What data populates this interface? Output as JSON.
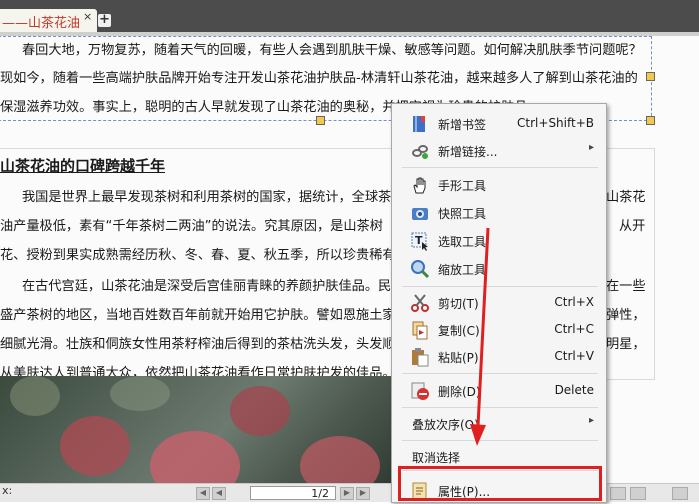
{
  "tab": {
    "label": "——山茶花油",
    "close": "×",
    "add": "+"
  },
  "document": {
    "para1": [
      "春回大地，万物复苏，随着天气的回暖，有些人会遇到肌肤干燥、敏感等问题。如何解决肌肤季节问题呢？",
      "现如今，随着一些高端护肤品牌开始专注开发山茶花油护肤品-林清轩山茶花油，越来越多人了解到山茶花油的",
      "保湿滋养功效。事实上，聪明的古人早就发现了山茶花油的奥秘，并把它视为珍贵的护肤品。"
    ],
    "heading": "山茶花油的口碑跨越千年",
    "para2": [
      "我国是世界上最早发现茶树和利用茶树的国家，据统计，全球茶",
      "油产量极低，素有“千年茶树二两油”的说法。究其原因，是山茶树",
      "花、授粉到果实成熟需经历秋、冬、春、夏、秋五季，所以珍贵稀有"
    ],
    "para2_right": [
      "山茶花",
      "从开"
    ],
    "para3": [
      "在古代宫廷，山茶花油是深受后宫佳丽青睐的养颜护肤佳品。民",
      "盛产茶树的地区，当地百姓数百年前就开始用它护肤。譬如恩施土家",
      "细腻光滑。壮族和侗族女性用茶籽榨油后得到的茶枯洗头发，头发顺",
      "从美肤达人到普通大众，依然把山茶花油看作日常护肤护发的佳品。"
    ],
    "para3_right": [
      "在一些",
      "弹性，",
      "明星，"
    ]
  },
  "status": {
    "left": "x:",
    "page": "1/2"
  },
  "context_menu": {
    "items": [
      {
        "label": "新增书签",
        "shortcut": "Ctrl+Shift+B",
        "icon": "bookmark-icon"
      },
      {
        "label": "新增链接...",
        "submenu": "▸",
        "icon": "link-icon"
      },
      {
        "label": "手形工具",
        "icon": "hand-icon"
      },
      {
        "label": "快照工具",
        "icon": "camera-icon"
      },
      {
        "label": "选取工具",
        "icon": "text-select-icon"
      },
      {
        "label": "缩放工具",
        "icon": "zoom-icon"
      },
      {
        "label": "剪切(T)",
        "shortcut": "Ctrl+X",
        "icon": "scissors-icon"
      },
      {
        "label": "复制(C)",
        "shortcut": "Ctrl+C",
        "icon": "copy-icon"
      },
      {
        "label": "粘贴(P)",
        "shortcut": "Ctrl+V",
        "icon": "paste-icon"
      },
      {
        "label": "删除(D)",
        "shortcut": "Delete",
        "icon": "delete-icon"
      },
      {
        "label": "叠放次序(O)",
        "submenu": "▸"
      },
      {
        "label": "取消选择"
      },
      {
        "label": "属性(P)...",
        "icon": "properties-icon"
      }
    ]
  },
  "colors": {
    "highlight": "#e02020",
    "tab_text": "#c0392b",
    "selection": "#6f8fd0"
  }
}
